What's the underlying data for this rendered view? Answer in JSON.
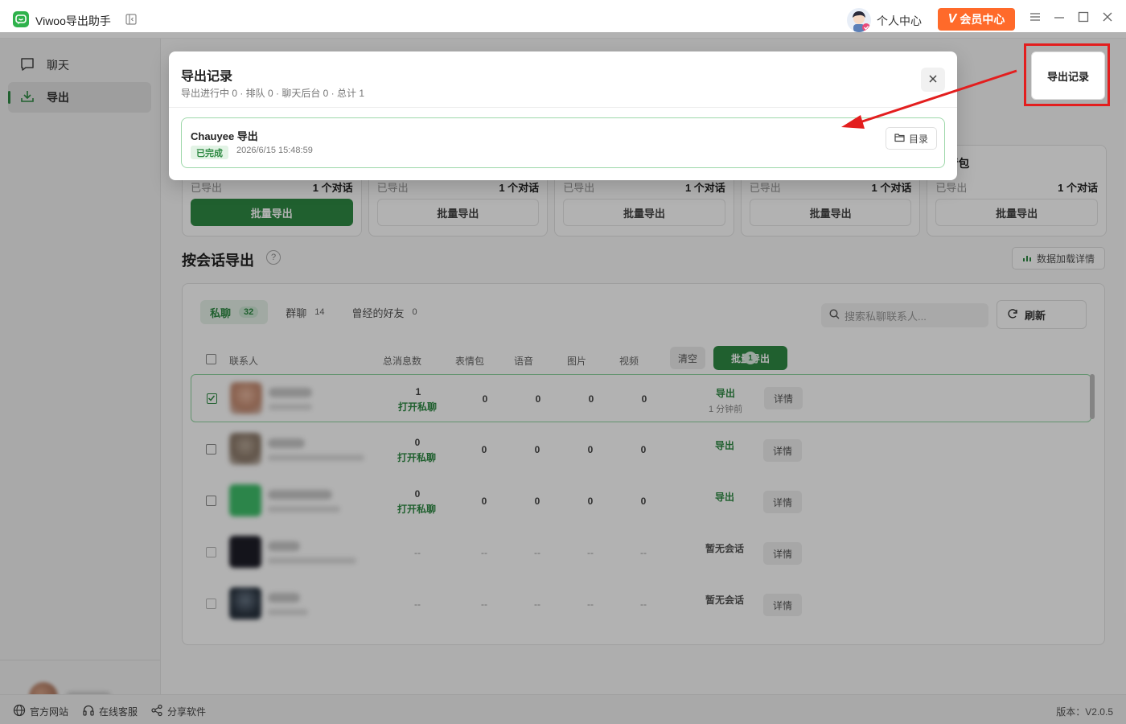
{
  "app": {
    "title": "Viwoo导出助手",
    "user_center": "个人中心",
    "vip_label": "会员中心",
    "vip_mark": "V"
  },
  "sidebar": {
    "items": [
      {
        "label": "聊天",
        "icon": "chat-bubble-icon",
        "active": false
      },
      {
        "label": "导出",
        "icon": "download-icon",
        "active": true
      }
    ]
  },
  "cards": [
    {
      "title": "",
      "done_label": "已导出",
      "count": "1 个对话",
      "button": "批量导出",
      "primary": true
    },
    {
      "title": "",
      "done_label": "已导出",
      "count": "1 个对话",
      "button": "批量导出",
      "primary": false
    },
    {
      "title": "",
      "done_label": "已导出",
      "count": "1 个对话",
      "button": "批量导出",
      "primary": false
    },
    {
      "title": "",
      "done_label": "已导出",
      "count": "1 个对话",
      "button": "批量导出",
      "primary": false
    },
    {
      "title": "表情包",
      "done_label": "已导出",
      "count": "1 个对话",
      "button": "批量导出",
      "primary": false
    }
  ],
  "section": {
    "title": "按会话导出",
    "help": "?",
    "load_details": "数据加载详情"
  },
  "tabs": [
    {
      "label": "私聊",
      "count": "32",
      "active": true
    },
    {
      "label": "群聊",
      "count": "14",
      "active": false
    },
    {
      "label": "曾经的好友",
      "count": "0",
      "active": false
    }
  ],
  "search": {
    "placeholder": "搜索私聊联系人..."
  },
  "refresh_label": "刷新",
  "table": {
    "headers": {
      "contact": "联系人",
      "total": "总消息数",
      "stickers": "表情包",
      "voice": "语音",
      "images": "图片",
      "video": "视频",
      "clear": "清空",
      "bulk_export": "批量导出",
      "bulk_count": "1"
    },
    "rows": [
      {
        "checked": true,
        "total": "1",
        "open": "打开私聊",
        "stickers": "0",
        "voice": "0",
        "images": "0",
        "video": "0",
        "action": "导出",
        "action_sub": "1 分钟前",
        "detail": "详情"
      },
      {
        "checked": false,
        "total": "0",
        "open": "打开私聊",
        "stickers": "0",
        "voice": "0",
        "images": "0",
        "video": "0",
        "action": "导出",
        "action_sub": "",
        "detail": "详情"
      },
      {
        "checked": false,
        "total": "0",
        "open": "打开私聊",
        "stickers": "0",
        "voice": "0",
        "images": "0",
        "video": "0",
        "action": "导出",
        "action_sub": "",
        "detail": "详情"
      },
      {
        "checked": false,
        "total": "--",
        "open": "",
        "stickers": "--",
        "voice": "--",
        "images": "--",
        "video": "--",
        "action": "暂无会话",
        "action_sub": "",
        "detail": "详情"
      },
      {
        "checked": false,
        "total": "--",
        "open": "",
        "stickers": "--",
        "voice": "--",
        "images": "--",
        "video": "--",
        "action": "暂无会话",
        "action_sub": "",
        "detail": "详情"
      }
    ]
  },
  "footer": {
    "website": "官方网站",
    "support": "在线客服",
    "share": "分享软件",
    "version": "版本：V2.0.5"
  },
  "modal": {
    "title": "导出记录",
    "subtitle": "导出进行中 0 · 排队 0 · 聊天后台 0 · 总计 1",
    "record": {
      "name": "Chauyee 导出",
      "status": "已完成",
      "time": "2026/6/15 15:48:59",
      "dir_button": "目录"
    }
  },
  "export_records_button": "导出记录",
  "colors": {
    "accent": "#2f8a44",
    "vip": "#ff6a2a",
    "highlight": "#e31e1e"
  }
}
